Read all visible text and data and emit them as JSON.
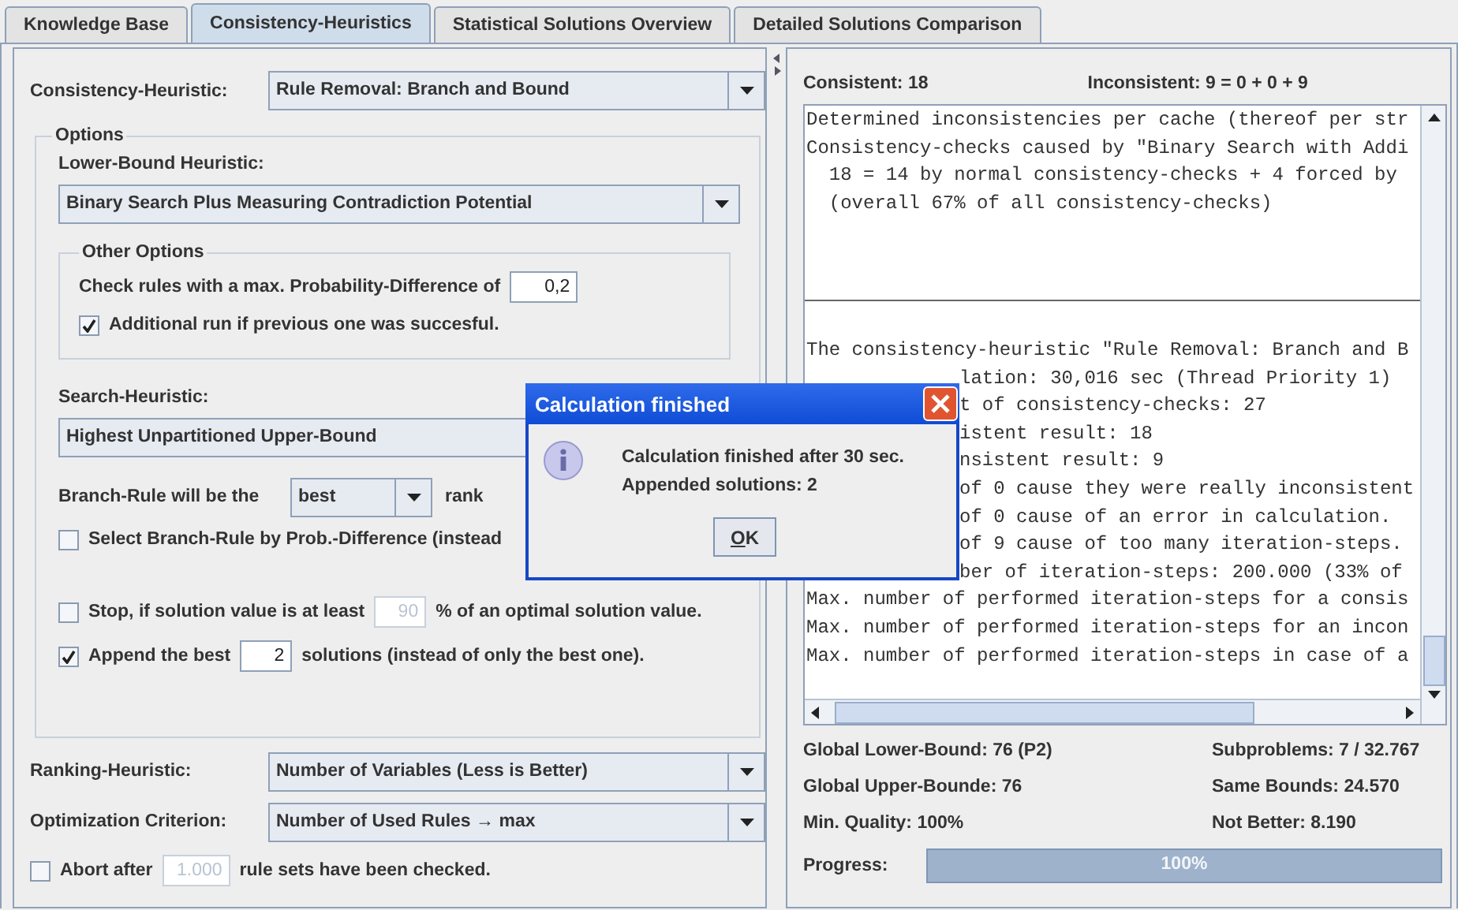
{
  "tabs": [
    {
      "label": "Knowledge Base",
      "selected": false
    },
    {
      "label": "Consistency-Heuristics",
      "selected": true
    },
    {
      "label": "Statistical Solutions Overview",
      "selected": false
    },
    {
      "label": "Detailed Solutions Comparison",
      "selected": false
    }
  ],
  "heuristic_panel": {
    "consistency_heuristic": {
      "label": "Consistency-Heuristic:",
      "value": "Rule Removal: Branch and Bound"
    },
    "options": {
      "title": "Options",
      "lower_bound": {
        "label": "Lower-Bound Heuristic:",
        "value": "Binary Search Plus Measuring Contradiction Potential"
      },
      "other_options": {
        "title": "Other Options",
        "prob_diff": {
          "label": "Check rules with a max. Probability-Difference of",
          "value": "0,2"
        },
        "additional_run": {
          "label": "Additional run if previous one was succesful.",
          "checked": true
        }
      },
      "search_heuristic": {
        "label": "Search-Heuristic:",
        "value": "Highest Unpartitioned Upper-Bound"
      },
      "branch_rule": {
        "label_before": "Branch-Rule will be the",
        "value": "best",
        "label_after": "rank"
      },
      "select_by_prob": {
        "label": "Select Branch-Rule by Prob.-Difference (instead",
        "checked": false
      },
      "stop": {
        "label_before": "Stop, if solution value is at least",
        "value": "90",
        "label_after": "% of an optimal solution value.",
        "checked": false
      },
      "append": {
        "label_before": "Append the best",
        "value": "2",
        "label_after": "solutions (instead of only the best one).",
        "checked": true
      }
    },
    "ranking_heuristic": {
      "label": "Ranking-Heuristic:",
      "value": "Number of Variables (Less is Better)"
    },
    "optimization_criterion": {
      "label": "Optimization Criterion:",
      "value": "Number of Used Rules → max"
    },
    "abort": {
      "label_before": "Abort after",
      "value": "1.000",
      "label_after": "rule sets have been checked.",
      "checked": false
    }
  },
  "results": {
    "consistent": "Consistent: 18",
    "inconsistent": "Inconsistent: 9 = 0 + 0 + 9",
    "log_top": [
      {
        "text": "Determined inconsistencies per cache (thereof per str",
        "kind": "full"
      },
      {
        "text": "Consistency-checks caused by \"Binary Search with Addi",
        "kind": "full"
      },
      {
        "text": "  18 = 14 by normal consistency-checks + 4 forced by",
        "kind": "full"
      },
      {
        "text": "  (overall 67% of all consistency-checks)",
        "kind": "full"
      }
    ],
    "log_bottom": [
      {
        "text": "The consistency-heuristic \"Rule Removal: Branch and B",
        "kind": "full"
      },
      {
        "text": "lation: 30,016 sec (Thread Priority 1)",
        "kind": "tail"
      },
      {
        "text": "t of consistency-checks: 27",
        "kind": "tail"
      },
      {
        "text": "istent result: 18",
        "kind": "tail"
      },
      {
        "text": "nsistent result: 9",
        "kind": "tail"
      },
      {
        "text": "of 0 cause they were really inconsistent",
        "kind": "tail"
      },
      {
        "text": "of 0 cause of an error in calculation.",
        "kind": "tail"
      },
      {
        "text": "of 9 cause of too many iteration-steps.",
        "kind": "tail"
      },
      {
        "text": "ber of iteration-steps: 200.000 (33% of",
        "kind": "tail"
      },
      {
        "text": "Max. number of performed iteration-steps for a consis",
        "kind": "full"
      },
      {
        "text": "Max. number of performed iteration-steps for an incon",
        "kind": "full"
      },
      {
        "text": "Max. number of performed iteration-steps in case of a",
        "kind": "full"
      }
    ],
    "stats": [
      {
        "left": "Global Lower-Bound: 76 (P2)",
        "right": "Subproblems: 7 / 32.767"
      },
      {
        "left": "Global Upper-Bounde: 76",
        "right": "Same Bounds: 24.570"
      },
      {
        "left": "Min. Quality: 100%",
        "right": "Not Better: 8.190"
      }
    ],
    "progress": {
      "label": "Progress:",
      "level": 1,
      "text": "100%"
    }
  },
  "dialog": {
    "title": "Calculation finished",
    "messages": [
      "Calculation finished after 30 sec.",
      "Appended solutions: 2"
    ],
    "button": "OK"
  }
}
